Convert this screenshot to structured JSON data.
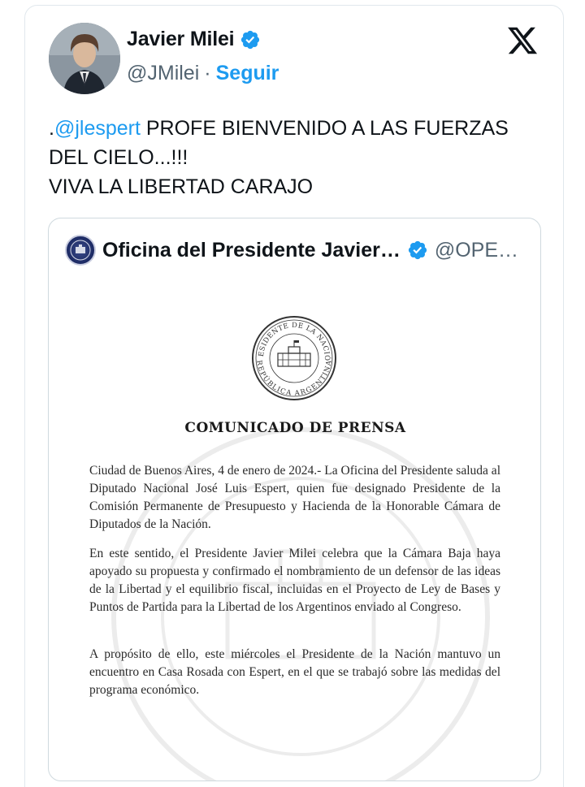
{
  "tweet": {
    "author": {
      "display_name": "Javier Milei",
      "handle": "@JMilei",
      "separator": "·",
      "follow_label": "Seguir",
      "verified_color": "#1d9bf0"
    },
    "text": {
      "prefix": ".",
      "mention": "@jlespert",
      "line1_rest": " PROFE BIENVENIDO A LAS FUERZAS DEL CIELO...!!!",
      "line2": "VIVA LA LIBERTAD CARAJO"
    },
    "brand_icon": "x-logo-icon"
  },
  "quoted_tweet": {
    "author": {
      "display_name": "Oficina del Presidente Javier…",
      "handle": "@OPE…"
    },
    "document": {
      "seal_text_top": "PRESIDENTE DE LA NACIÓN",
      "seal_text_bottom": "REPÚBLICA ARGENTINA",
      "title": "COMUNICADO DE PRENSA",
      "paragraphs": [
        "Ciudad de Buenos Aires, 4 de enero de 2024.- La Oficina del Presidente saluda al Diputado Nacional José Luis Espert, quien fue designado Presidente de la Comisión Permanente de Presupuesto y Hacienda de la Honorable Cámara de Diputados de la Nación.",
        "En este sentido, el Presidente Javier Milei celebra que la Cámara Baja haya apoyado su propuesta y confirmado el nombramiento de un defensor de las ideas de la Libertad y el equilibrio fiscal, incluidas en el Proyecto de Ley de Bases y Puntos de Partida para la Libertad de los Argentinos enviado al Congreso.",
        "A propósito de ello, este miércoles el Presidente de la Nación mantuvo un encuentro en Casa Rosada con Espert, en el que se trabajó sobre las medidas del programa económico."
      ]
    }
  },
  "colors": {
    "accent": "#1d9bf0",
    "text": "#0f1419",
    "secondary": "#536471",
    "border": "#cfd9de"
  }
}
